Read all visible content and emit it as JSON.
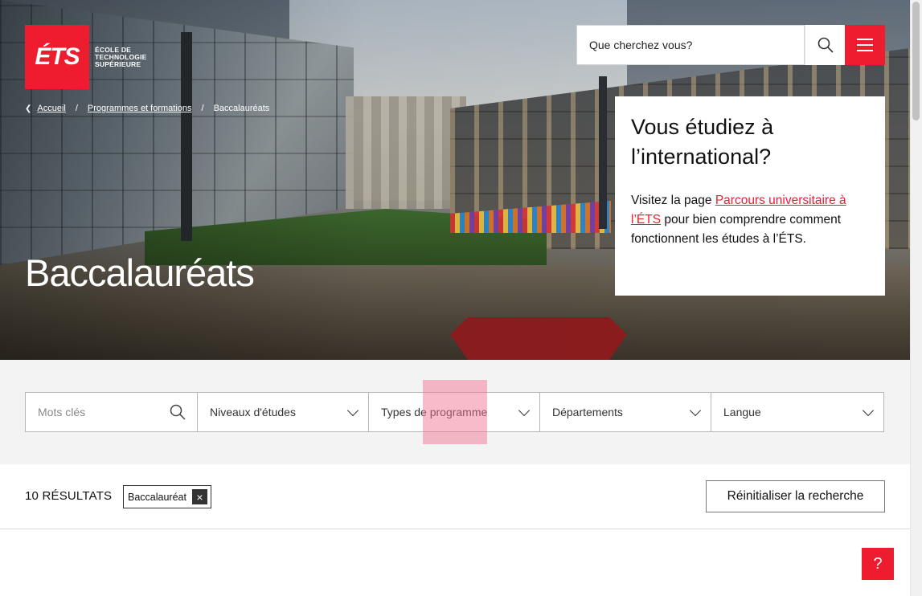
{
  "logo": {
    "mark": "ÉTS",
    "text": "ÉCOLE DE TECHNOLOGIE SUPÉRIEURE"
  },
  "header": {
    "search_placeholder": "Que cherchez vous?",
    "search_icon": "search-icon",
    "menu_icon": "hamburger-icon"
  },
  "breadcrumb": {
    "items": [
      "Accueil",
      "Programmes et formations",
      "Baccalauréats"
    ],
    "separator": "/"
  },
  "hero": {
    "title": "Baccalauréats"
  },
  "card": {
    "title": "Vous étudiez à l’international?",
    "text_before": "Visitez la page ",
    "link": "Parcours universitaire à l’ÉTS",
    "text_after": " pour bien comprendre comment fonctionnent les études à l’ÉTS."
  },
  "filters": {
    "keywords_placeholder": "Mots clés",
    "selects": [
      "Niveaux d'études",
      "Types de programme",
      "Départements",
      "Langue"
    ]
  },
  "results": {
    "count_label": "10 RÉSULTATS",
    "active_tag": "Baccalauréat",
    "reset_label": "Réinitialiser la recherche"
  },
  "help": {
    "label": "?"
  },
  "colors": {
    "brand_red": "#ed1c2e",
    "filter_bg": "#f3f3f3"
  }
}
